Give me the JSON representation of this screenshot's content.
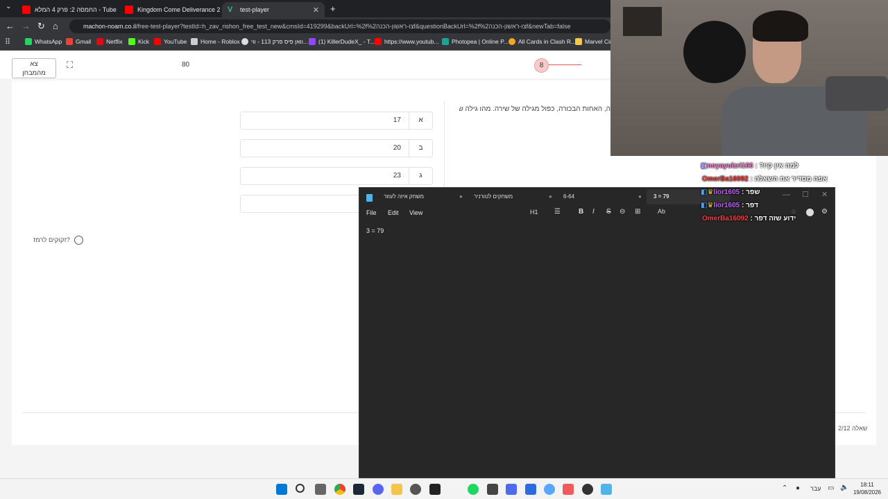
{
  "browser": {
    "tabs": [
      {
        "title": "החמסה 2: פרק 4 המלא - YouTube",
        "display": "החמסה 2: פרק 4 המלא - Tube"
      },
      {
        "title": "Kingdom Come Deliverance 2"
      },
      {
        "title": "test-player"
      }
    ],
    "url_host": "machon-noam.co.il",
    "url_path": "/free-test-player?testId=h_zav_rishon_free_test_new&cmsId=419299&backUrl=%2fצו-ראשון-הכנה%2f&questionBackUrl=%2fצו-ראשון-הכנה%2f&newTab=false",
    "bookmarks": [
      "WhatsApp",
      "Gmail",
      "Netflix",
      "Kick",
      "YouTube",
      "Home - Roblox",
      "וואן פיס פרק 113 - ווי...",
      "(1) KillerDudeX_ - T...",
      "https://www.youtub...",
      "Photopea | Online P...",
      "All Cards in Clash R...",
      "Marvel Cine"
    ]
  },
  "test": {
    "exit_label_1": "צא",
    "exit_label_2": "מהמבחן",
    "timer": "80",
    "question_number": "8",
    "question_text": "ה, האחות הבכורה, כפול מגילה של שירה. מהו גילה של",
    "options": [
      {
        "letter": "א",
        "value": "17"
      },
      {
        "letter": "ב",
        "value": "20"
      },
      {
        "letter": "ג",
        "value": "23"
      },
      {
        "letter": "",
        "value": ""
      }
    ],
    "hint": "זקוקים לרמז?",
    "counter": "שאלה 2/12"
  },
  "notepad": {
    "tabs": [
      "משחק איזה לעוזר",
      "משחקים לטורניר",
      "6-64",
      "3 = 79"
    ],
    "menu": [
      "File",
      "Edit",
      "View"
    ],
    "heading_btn": "H1",
    "content": "3 = 79"
  },
  "chat": [
    {
      "user": "noyayulzri166",
      "text": "?למה אין קיו",
      "color": "#ffffff"
    },
    {
      "user": "OmerBa16092",
      "text": "אפה מסדיר את השאלה",
      "color": "#ff3b3b"
    },
    {
      "user": "lior1605",
      "text": "שפר",
      "color": "#c15cff"
    },
    {
      "user": "lior1605",
      "text": "דפר",
      "color": "#c15cff"
    },
    {
      "user": "OmerBa16092",
      "text": "ידוע שזה דפר",
      "color": "#ff3b3b"
    }
  ],
  "taskbar": {
    "lang": "עבר",
    "time": "18:11",
    "date": "19/08/2026"
  }
}
